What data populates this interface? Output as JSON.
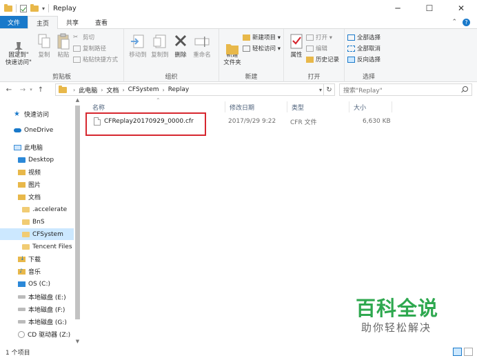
{
  "window": {
    "title": "Replay",
    "minimize": "─",
    "maximize": "☐",
    "close": "✕"
  },
  "ribbon_tabs": {
    "file": "文件",
    "home": "主页",
    "share": "共享",
    "view": "查看"
  },
  "ribbon": {
    "clipboard": {
      "label": "剪贴板",
      "pin": "固定到\"\n快速访问\"",
      "copy": "复制",
      "paste": "粘贴",
      "cut": "剪切",
      "copy_path": "复制路径",
      "paste_shortcut": "粘贴快捷方式"
    },
    "organize": {
      "label": "组织",
      "move_to": "移动到",
      "copy_to": "复制到",
      "delete": "删除",
      "rename": "重命名"
    },
    "new": {
      "label": "新建",
      "new_folder": "新建\n文件夹",
      "new_item": "新建项目 ▾",
      "easy_access": "轻松访问 ▾"
    },
    "open": {
      "label": "打开",
      "properties": "属性",
      "open": "打开 ▾",
      "edit": "编辑",
      "history": "历史记录"
    },
    "select": {
      "label": "选择",
      "select_all": "全部选择",
      "select_none": "全部取消",
      "invert": "反向选择"
    }
  },
  "address": {
    "crumbs": [
      "此电脑",
      "文档",
      "CFSystem",
      "Replay"
    ],
    "search_placeholder": "搜索\"Replay\""
  },
  "nav": {
    "items": [
      {
        "label": "快速访问"
      },
      {
        "label": "OneDrive"
      },
      {
        "label": "此电脑"
      },
      {
        "label": "Desktop"
      },
      {
        "label": "视频"
      },
      {
        "label": "图片"
      },
      {
        "label": "文档"
      },
      {
        "label": ".accelerate"
      },
      {
        "label": "BnS"
      },
      {
        "label": "CFSystem"
      },
      {
        "label": "Tencent Files"
      },
      {
        "label": "下载"
      },
      {
        "label": "音乐"
      },
      {
        "label": "OS (C:)"
      },
      {
        "label": "本地磁盘 (E:)"
      },
      {
        "label": "本地磁盘 (F:)"
      },
      {
        "label": "本地磁盘 (G:)"
      },
      {
        "label": "CD 驱动器 (Z:)"
      }
    ]
  },
  "columns": {
    "name": "名称",
    "modified": "修改日期",
    "type": "类型",
    "size": "大小"
  },
  "files": [
    {
      "name": "CFReplay20170929_0000.cfr",
      "modified": "2017/9/29 9:22",
      "type": "CFR 文件",
      "size": "6,630 KB"
    }
  ],
  "status": {
    "count": "1 个项目"
  },
  "watermark": {
    "title": "百科全说",
    "subtitle": "助你轻松解决"
  },
  "colors": {
    "accent": "#1979ca",
    "highlight_box": "#d6262e",
    "watermark_green": "#2ea84f"
  }
}
